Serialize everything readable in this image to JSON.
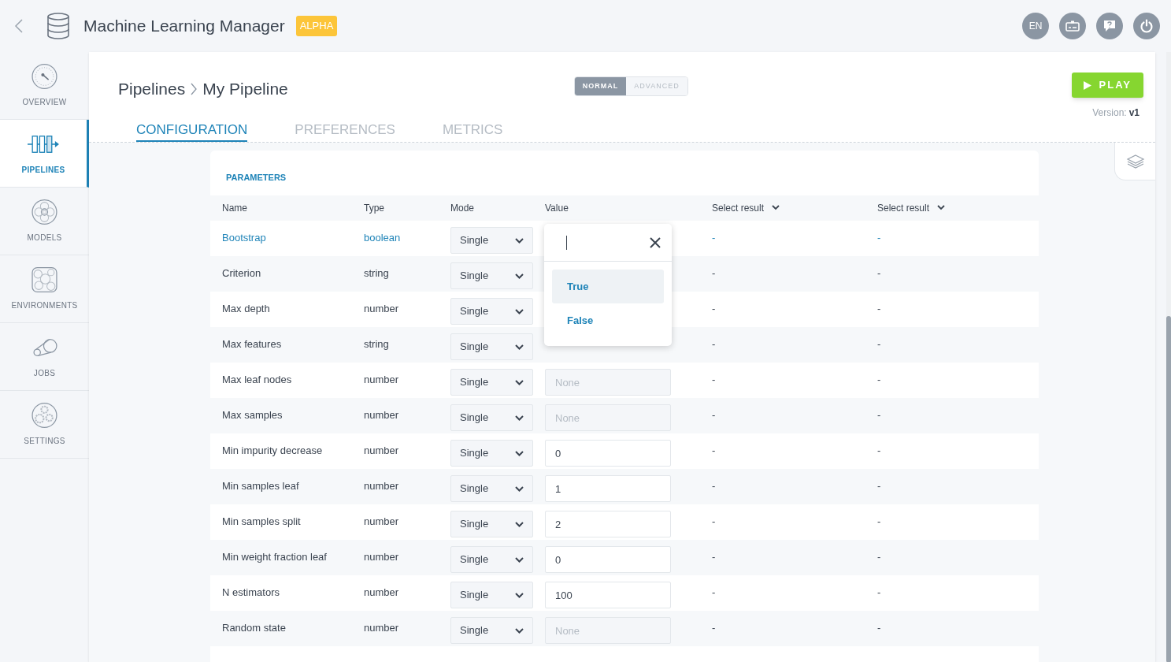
{
  "app": {
    "title": "Machine Learning Manager",
    "badge": "ALPHA",
    "language": "EN"
  },
  "sidebar": {
    "items": [
      {
        "label": "OVERVIEW",
        "kind": "overview",
        "selected": false
      },
      {
        "label": "PIPELINES",
        "kind": "pipelines",
        "selected": true
      },
      {
        "label": "MODELS",
        "kind": "models",
        "selected": false
      },
      {
        "label": "ENVIRONMENTS",
        "kind": "environments",
        "selected": false
      },
      {
        "label": "JOBS",
        "kind": "jobs",
        "selected": false
      },
      {
        "label": "SETTINGS",
        "kind": "settings",
        "selected": false
      }
    ]
  },
  "breadcrumb": [
    "Pipelines",
    "My Pipeline"
  ],
  "mode_toggle": [
    {
      "label": "NORMAL",
      "selected": true
    },
    {
      "label": "ADVANCED",
      "selected": false
    }
  ],
  "play_button": "PLAY",
  "version_label": "Version:",
  "version": "v1",
  "tabs": [
    {
      "label": "CONFIGURATION",
      "selected": true
    },
    {
      "label": "PREFERENCES",
      "selected": false
    },
    {
      "label": "METRICS",
      "selected": false
    }
  ],
  "parameters": {
    "title": "PARAMETERS",
    "columns": [
      "Name",
      "Type",
      "Mode",
      "Value",
      "Select result",
      "Select result"
    ],
    "rows": [
      {
        "name": "Bootstrap",
        "type": "boolean",
        "mode": "Single",
        "link": true,
        "result_1": "-",
        "result_2": "-"
      },
      {
        "name": "Criterion",
        "type": "string",
        "mode": "Single",
        "link": false,
        "result_1": "-",
        "result_2": "-"
      },
      {
        "name": "Max depth",
        "type": "number",
        "mode": "Single",
        "link": false,
        "result_1": "-",
        "result_2": "-"
      },
      {
        "name": "Max features",
        "type": "string",
        "mode": "Single",
        "link": false,
        "result_1": "-",
        "result_2": "-"
      },
      {
        "name": "Max leaf nodes",
        "type": "number",
        "mode": "Single",
        "link": false,
        "placeholder": "None",
        "result_1": "-",
        "result_2": "-"
      },
      {
        "name": "Max samples",
        "type": "number",
        "mode": "Single",
        "link": false,
        "placeholder": "None",
        "result_1": "-",
        "result_2": "-"
      },
      {
        "name": "Min impurity decrease",
        "type": "number",
        "mode": "Single",
        "link": false,
        "value": "0",
        "result_1": "-",
        "result_2": "-"
      },
      {
        "name": "Min samples leaf",
        "type": "number",
        "mode": "Single",
        "link": false,
        "value": "1",
        "result_1": "-",
        "result_2": "-"
      },
      {
        "name": "Min samples split",
        "type": "number",
        "mode": "Single",
        "link": false,
        "value": "2",
        "result_1": "-",
        "result_2": "-"
      },
      {
        "name": "Min weight fraction leaf",
        "type": "number",
        "mode": "Single",
        "link": false,
        "value": "0",
        "result_1": "-",
        "result_2": "-"
      },
      {
        "name": "N estimators",
        "type": "number",
        "mode": "Single",
        "link": false,
        "value": "100",
        "result_1": "-",
        "result_2": "-"
      },
      {
        "name": "Random state",
        "type": "number",
        "mode": "Single",
        "link": false,
        "placeholder": "None",
        "result_1": "-",
        "result_2": "-"
      }
    ]
  },
  "value_dropdown": {
    "options": [
      {
        "label": "True",
        "selected": true
      },
      {
        "label": "False",
        "selected": false
      }
    ]
  }
}
